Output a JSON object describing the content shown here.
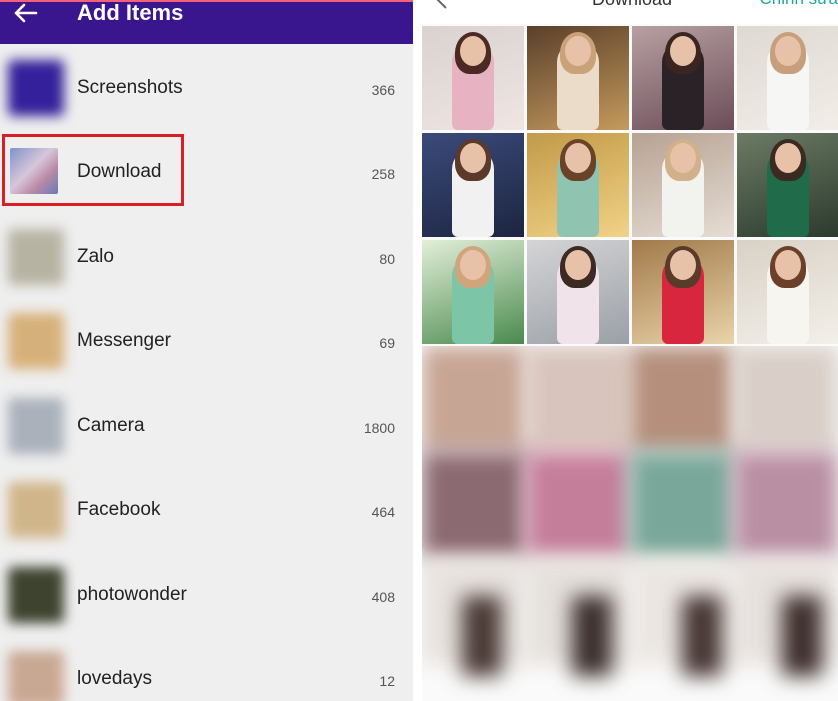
{
  "header": {
    "title": "Add Items"
  },
  "albums": [
    {
      "name": "Screenshots",
      "count": "366",
      "thumb": "#33209a"
    },
    {
      "name": "Download",
      "count": "258",
      "thumb": "#a9a6cf"
    },
    {
      "name": "Zalo",
      "count": "80",
      "thumb": "#b7b3a3"
    },
    {
      "name": "Messenger",
      "count": "69",
      "thumb": "#d6b07a"
    },
    {
      "name": "Camera",
      "count": "1800",
      "thumb": "#aab1bb"
    },
    {
      "name": "Facebook",
      "count": "464",
      "thumb": "#d0b58a"
    },
    {
      "name": "photowonder",
      "count": "408",
      "thumb": "#3e432f"
    },
    {
      "name": "lovedays",
      "count": "12",
      "thumb": "#c9a893"
    }
  ],
  "gallery": {
    "title": "Download",
    "edit_label": "Chỉnh sửa"
  },
  "colors": {
    "topbar": "#3a168e",
    "highlight_box": "#d91e26",
    "edit_accent": "#21a69a"
  }
}
